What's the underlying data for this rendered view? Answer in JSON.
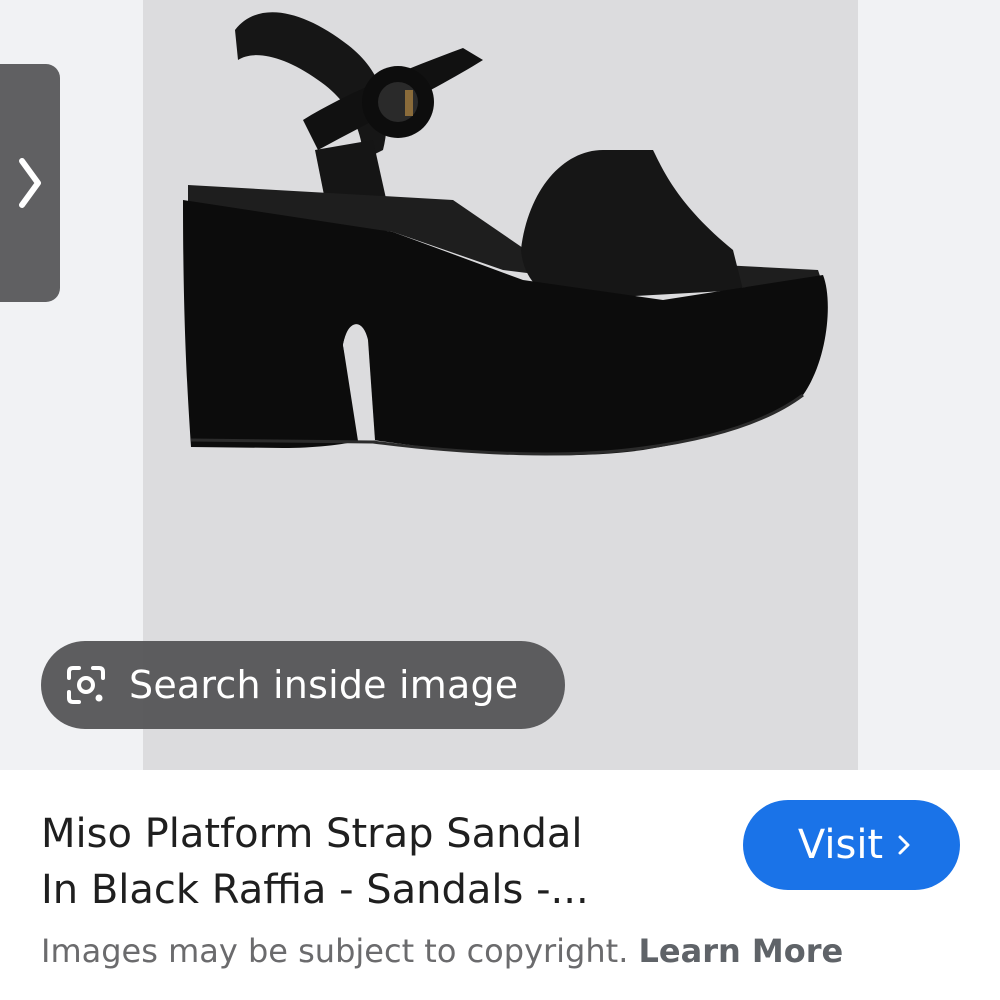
{
  "image_viewer": {
    "search_inside_label": "Search inside image",
    "image_subject": "black platform sandal with ankle strap"
  },
  "result": {
    "title_line1": "Miso Platform Strap Sandal",
    "title_line2": "In Black Raffia - Sandals -...",
    "visit_label": "Visit",
    "copyright_text": "Images may be subject to copyright.",
    "learn_more_label": "Learn More"
  },
  "colors": {
    "visit_button": "#1a73e8",
    "pill_background": "#545456",
    "image_background": "#dcdcde"
  },
  "icons": {
    "prev": "chevron-right-icon",
    "lens": "google-lens-icon",
    "visit": "chevron-right-icon"
  }
}
